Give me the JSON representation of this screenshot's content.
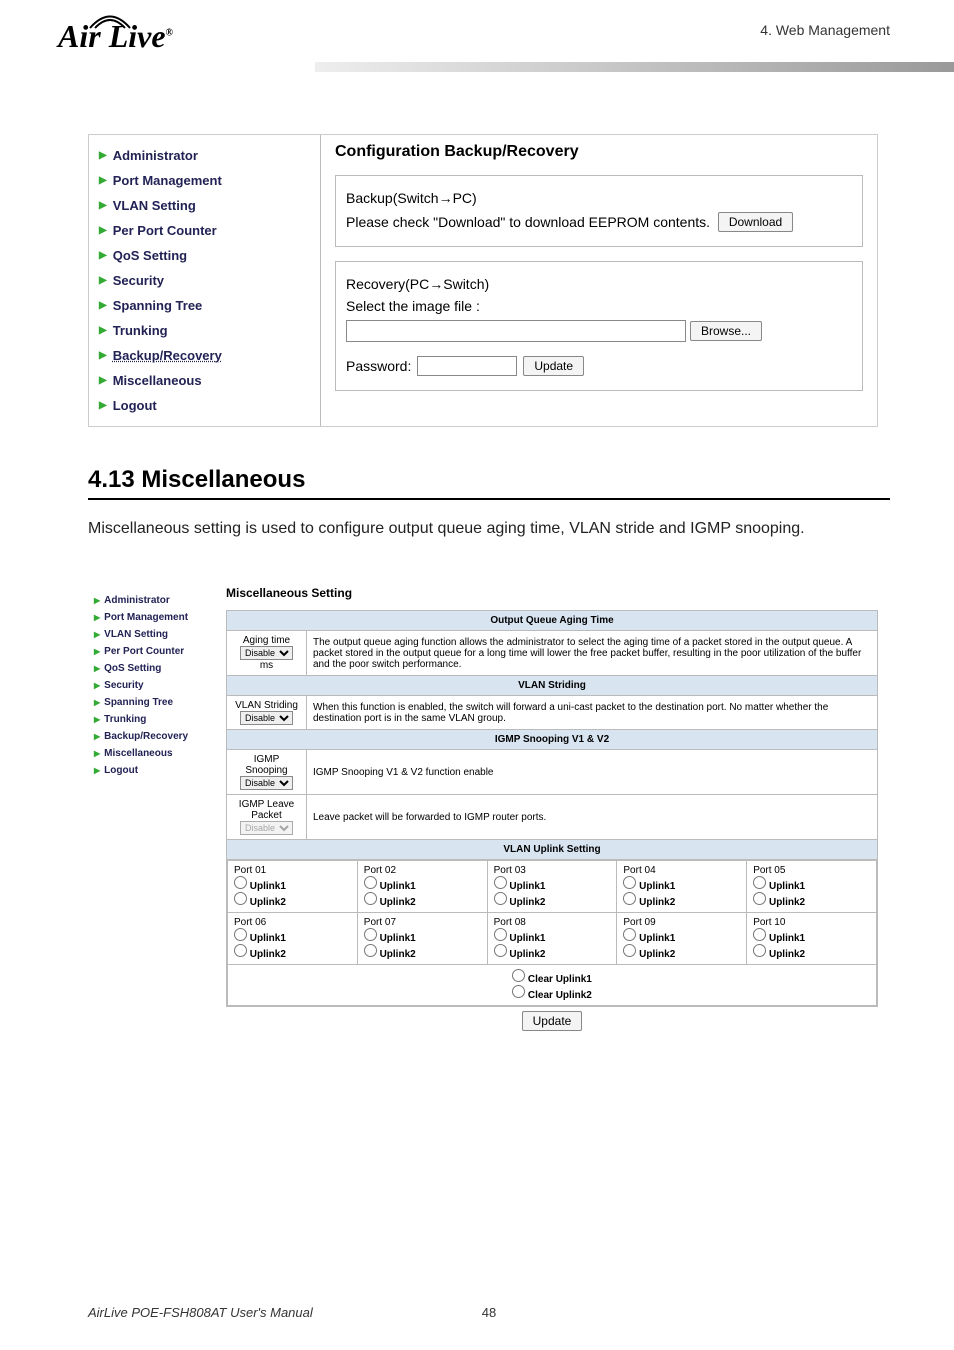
{
  "header": {
    "logo_text": "Air Live",
    "logo_reg": "®",
    "chapter": "4. Web Management"
  },
  "screenshot1": {
    "sidebar": [
      "Administrator",
      "Port Management",
      "VLAN Setting",
      "Per Port Counter",
      "QoS Setting",
      "Security",
      "Spanning Tree",
      "Trunking",
      "Backup/Recovery",
      "Miscellaneous",
      "Logout"
    ],
    "title": "Configuration Backup/Recovery",
    "backup_header": "Backup(Switch→PC)",
    "backup_text": "Please check \"Download\" to download EEPROM contents.",
    "download_btn": "Download",
    "recovery_header": "Recovery(PC→Switch)",
    "recovery_text": "Select the image file :",
    "browse_btn": "Browse...",
    "password_label": "Password:",
    "update_btn": "Update"
  },
  "section": {
    "heading": "4.13 Miscellaneous",
    "para": "Miscellaneous setting is used to configure output queue aging time, VLAN stride and IGMP snooping."
  },
  "screenshot2": {
    "sidebar": [
      "Administrator",
      "Port Management",
      "VLAN Setting",
      "Per Port Counter",
      "QoS Setting",
      "Security",
      "Spanning Tree",
      "Trunking",
      "Backup/Recovery",
      "Miscellaneous",
      "Logout"
    ],
    "title": "Miscellaneous Setting",
    "rows": {
      "aging_hdr": "Output Queue Aging Time",
      "aging_lbl": "Aging time",
      "aging_sel": "Disable",
      "aging_unit": "ms",
      "aging_desc": "The output queue aging function allows the administrator to select the aging time of a packet stored in the output queue. A packet stored in the output queue for a long time will lower the free packet buffer, resulting in the poor utilization of the buffer and the poor switch performance.",
      "striding_hdr": "VLAN Striding",
      "striding_lbl": "VLAN Striding",
      "striding_sel": "Disable",
      "striding_desc": "When this function is enabled, the switch will forward a uni-cast packet to the destination port. No matter whether the destination port is in the same VLAN group.",
      "igmp_hdr": "IGMP Snooping V1 & V2",
      "igmp_snoop_lbl": "IGMP Snooping",
      "igmp_snoop_sel": "Disable",
      "igmp_snoop_desc": "IGMP Snooping V1 & V2 function enable",
      "igmp_leave_lbl": "IGMP Leave Packet",
      "igmp_leave_sel": "Disable",
      "igmp_leave_desc": "Leave packet will be forwarded to IGMP router ports.",
      "uplink_hdr": "VLAN Uplink Setting"
    },
    "uplink_ports": [
      {
        "p": "Port 01",
        "u1": "Uplink1",
        "u2": "Uplink2"
      },
      {
        "p": "Port 02",
        "u1": "Uplink1",
        "u2": "Uplink2"
      },
      {
        "p": "Port 03",
        "u1": "Uplink1",
        "u2": "Uplink2"
      },
      {
        "p": "Port 04",
        "u1": "Uplink1",
        "u2": "Uplink2"
      },
      {
        "p": "Port 05",
        "u1": "Uplink1",
        "u2": "Uplink2"
      },
      {
        "p": "Port 06",
        "u1": "Uplink1",
        "u2": "Uplink2"
      },
      {
        "p": "Port 07",
        "u1": "Uplink1",
        "u2": "Uplink2"
      },
      {
        "p": "Port 08",
        "u1": "Uplink1",
        "u2": "Uplink2"
      },
      {
        "p": "Port 09",
        "u1": "Uplink1",
        "u2": "Uplink2"
      },
      {
        "p": "Port 10",
        "u1": "Uplink1",
        "u2": "Uplink2"
      }
    ],
    "clear1": "Clear Uplink1",
    "clear2": "Clear Uplink2",
    "update_btn": "Update"
  },
  "footer": {
    "manual": "AirLive POE-FSH808AT User's Manual",
    "page": "48"
  }
}
